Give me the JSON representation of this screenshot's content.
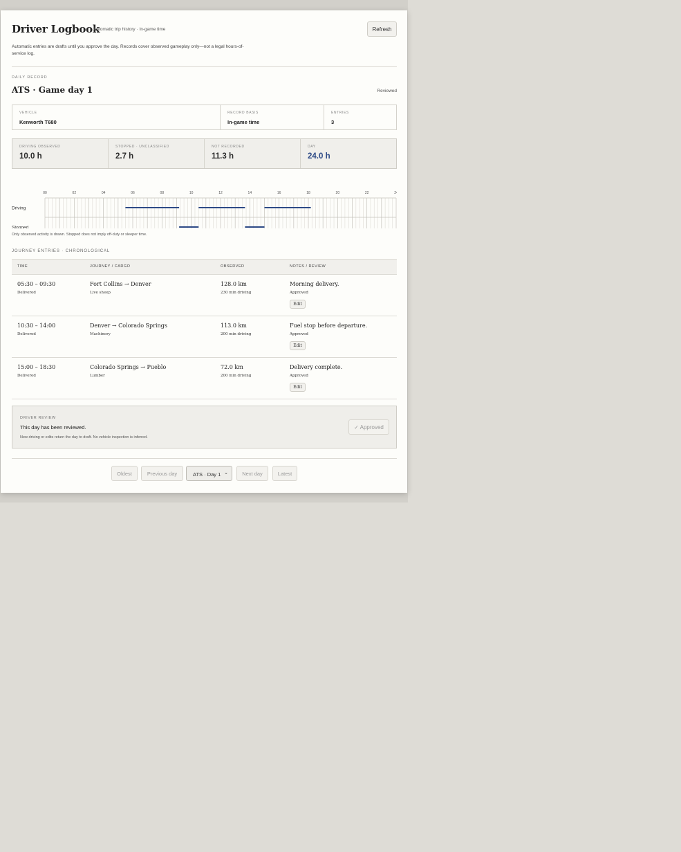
{
  "header": {
    "title": "Driver Logbook",
    "subtitle": "Automatic trip history · In-game time",
    "refresh_label": "Refresh",
    "intro": "Automatic entries are drafts until you approve the day. Records cover observed gameplay only—not a legal hours-of-service log."
  },
  "day": {
    "section_label": "DAILY RECORD",
    "title": "ATS · Game day 1",
    "status": "Reviewed",
    "info": [
      {
        "label": "VEHICLE",
        "value": "Kenworth T680"
      },
      {
        "label": "RECORD BASIS",
        "value": "In-game time"
      },
      {
        "label": "ENTRIES",
        "value": "3"
      }
    ],
    "stats": [
      {
        "label": "DRIVING OBSERVED",
        "value": "10.0 h"
      },
      {
        "label": "STOPPED · UNCLASSIFIED",
        "value": "2.7 h"
      },
      {
        "label": "NOT RECORDED",
        "value": "11.3 h"
      },
      {
        "label": "DAY",
        "value": "24.0 h"
      }
    ],
    "accent_color": "#2d4a86"
  },
  "timeline": {
    "hour_ticks": [
      "00",
      "02",
      "04",
      "06",
      "08",
      "10",
      "12",
      "14",
      "16",
      "18",
      "20",
      "22",
      "24"
    ],
    "rows": [
      {
        "label": "Driving",
        "segments": [
          [
            5.5,
            9.17
          ],
          [
            10.5,
            13.67
          ],
          [
            15.0,
            18.17
          ]
        ]
      },
      {
        "label": "Stopped",
        "segments": [
          [
            9.17,
            10.5
          ],
          [
            13.67,
            15.0
          ]
        ]
      }
    ],
    "bar_color": "#2d4a86",
    "note": "Only observed activity is drawn. Stopped does not imply off-duty or sleeper time."
  },
  "entries": {
    "section_label": "JOURNEY ENTRIES · CHRONOLOGICAL",
    "columns": [
      "TIME",
      "JOURNEY / CARGO",
      "OBSERVED",
      "NOTES / REVIEW"
    ],
    "rows": [
      {
        "time": "05:30 – 09:30",
        "status": "Delivered",
        "journey": "Fort Collins → Denver",
        "cargo": "Live sheep",
        "distance": "128.0 km",
        "driving": "230 min driving",
        "note": "Morning delivery.",
        "review": "Approved",
        "edit": "Edit"
      },
      {
        "time": "10:30 – 14:00",
        "status": "Delivered",
        "journey": "Denver → Colorado Springs",
        "cargo": "Machinery",
        "distance": "113.0 km",
        "driving": "200 min driving",
        "note": "Fuel stop before departure.",
        "review": "Approved",
        "edit": "Edit"
      },
      {
        "time": "15:00 – 18:30",
        "status": "Delivered",
        "journey": "Colorado Springs → Pueblo",
        "cargo": "Lumber",
        "distance": "72.0 km",
        "driving": "200 min driving",
        "note": "Delivery complete.",
        "review": "Approved",
        "edit": "Edit"
      }
    ]
  },
  "review": {
    "label": "DRIVER REVIEW",
    "message": "This day has been reviewed.",
    "note": "New driving or edits return the day to draft. No vehicle inspection is inferred.",
    "button": "✓ Approved"
  },
  "pager": {
    "oldest": "Oldest",
    "previous": "Previous day",
    "selected": "ATS · Day 1",
    "next": "Next day",
    "latest": "Latest"
  }
}
